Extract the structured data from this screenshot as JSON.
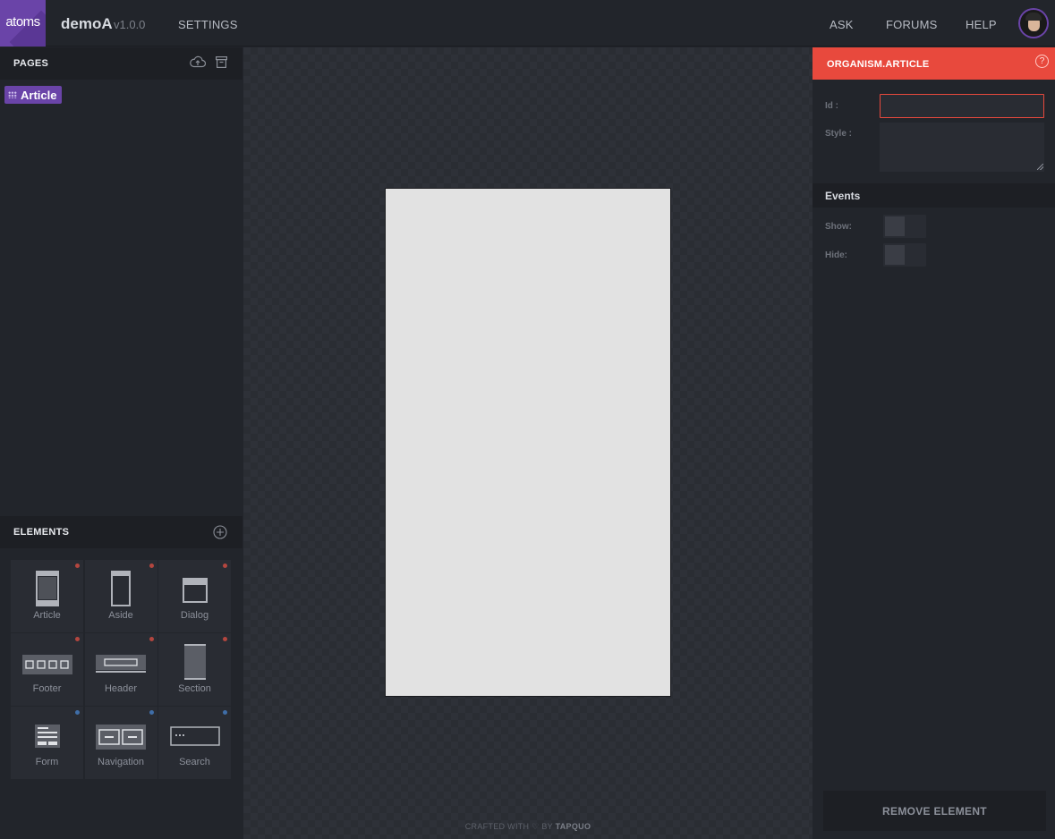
{
  "app": {
    "logo_text": "atoms",
    "title": "demoA",
    "version": "v1.0.0",
    "brand_color": "#6a44a8"
  },
  "topnav": {
    "settings": "SETTINGS",
    "ask": "ASK",
    "forums": "FORUMS",
    "help": "HELP"
  },
  "pages": {
    "title": "PAGES",
    "icons": [
      "cloud-upload-icon",
      "archive-icon"
    ],
    "items": [
      {
        "label": "Article"
      }
    ]
  },
  "elements": {
    "title": "ELEMENTS",
    "add_icon": "plus-circle-icon",
    "items": [
      {
        "label": "Article",
        "group": "organism",
        "dot_color": "#b3463f"
      },
      {
        "label": "Aside",
        "group": "organism",
        "dot_color": "#b3463f"
      },
      {
        "label": "Dialog",
        "group": "organism",
        "dot_color": "#b3463f"
      },
      {
        "label": "Footer",
        "group": "organism",
        "dot_color": "#b3463f"
      },
      {
        "label": "Header",
        "group": "organism",
        "dot_color": "#b3463f"
      },
      {
        "label": "Section",
        "group": "organism",
        "dot_color": "#b3463f"
      },
      {
        "label": "Form",
        "group": "molecule",
        "dot_color": "#3f6ea8"
      },
      {
        "label": "Navigation",
        "group": "molecule",
        "dot_color": "#3f6ea8"
      },
      {
        "label": "Search",
        "group": "molecule",
        "dot_color": "#3f6ea8"
      }
    ]
  },
  "canvas": {
    "credit_prefix": "CRAFTED WITH",
    "credit_heart": "♡",
    "credit_by": "BY",
    "credit_brand": "TAPQUO"
  },
  "inspector": {
    "title": "ORGANISM.ARTICLE",
    "accent_color": "#e8493d",
    "help_icon": "?",
    "id_label": "Id :",
    "id_value": "",
    "style_label": "Style :",
    "style_value": "",
    "events_title": "Events",
    "show_label": "Show:",
    "hide_label": "Hide:",
    "remove_button": "REMOVE ELEMENT"
  }
}
